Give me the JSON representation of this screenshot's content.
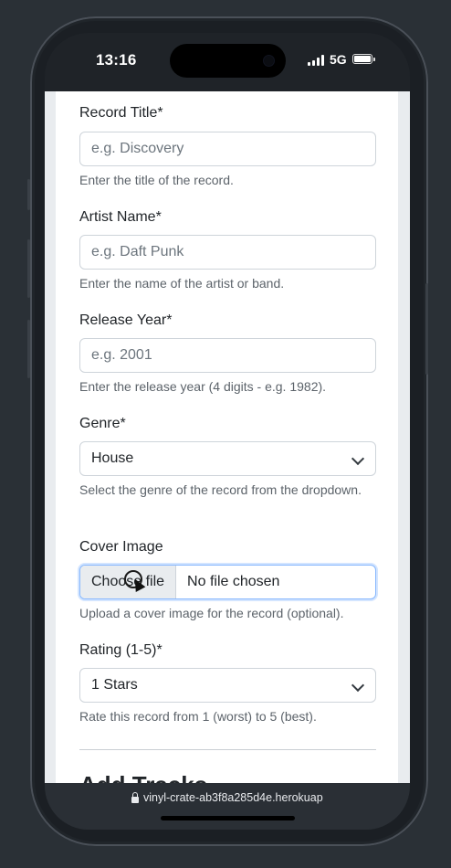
{
  "status": {
    "time": "13:16",
    "network": "5G"
  },
  "form": {
    "title": {
      "label": "Record Title*",
      "placeholder": "e.g. Discovery",
      "hint": "Enter the title of the record."
    },
    "artist": {
      "label": "Artist Name*",
      "placeholder": "e.g. Daft Punk",
      "hint": "Enter the name of the artist or band."
    },
    "year": {
      "label": "Release Year*",
      "placeholder": "e.g. 2001",
      "hint": "Enter the release year (4 digits - e.g. 1982)."
    },
    "genre": {
      "label": "Genre*",
      "value": "House",
      "hint": "Select the genre of the record from the dropdown."
    },
    "cover": {
      "label": "Cover Image",
      "button": "Choose file",
      "filename": "No file chosen",
      "hint": "Upload a cover image for the record (optional)."
    },
    "rating": {
      "label": "Rating (1-5)*",
      "value": "1 Stars",
      "hint": "Rate this record from 1 (worst) to 5 (best)."
    },
    "tracks_heading": "Add Tracks"
  },
  "browser": {
    "url": "vinyl-crate-ab3f8a285d4e.herokuap"
  },
  "icons": {
    "lock": "lock-icon",
    "chevron": "chevron-down-icon",
    "battery": "battery-icon",
    "signal": "signal-icon"
  }
}
